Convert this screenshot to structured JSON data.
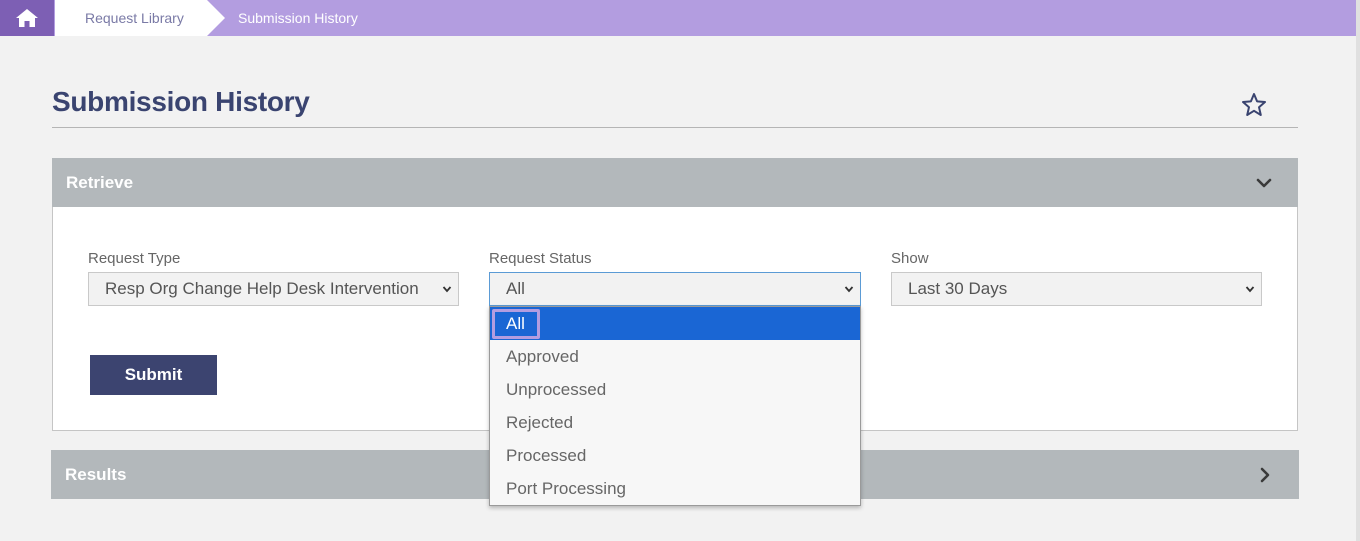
{
  "breadcrumb": {
    "home_icon": "home-icon",
    "items": [
      "Request Library",
      "Submission History"
    ]
  },
  "page": {
    "title": "Submission History",
    "favorite_icon": "star-icon"
  },
  "retrieve": {
    "label": "Retrieve",
    "toggle_icon": "chevron-down-icon",
    "request_type": {
      "label": "Request Type",
      "value": "Resp Org Change Help Desk Intervention"
    },
    "request_status": {
      "label": "Request Status",
      "value": "All",
      "options": [
        "All",
        "Approved",
        "Unprocessed",
        "Rejected",
        "Processed",
        "Port Processing"
      ]
    },
    "show": {
      "label": "Show",
      "value": "Last 30 Days"
    },
    "submit_label": "Submit"
  },
  "results": {
    "label": "Results",
    "toggle_icon": "chevron-right-icon"
  },
  "colors": {
    "breadcrumb_bar": "#b39de0",
    "home_tab": "#7d5fb4",
    "title": "#3a4470",
    "panel_header": "#b3b8bb",
    "submit_button": "#3c4470",
    "option_selected": "#1a66d4"
  }
}
